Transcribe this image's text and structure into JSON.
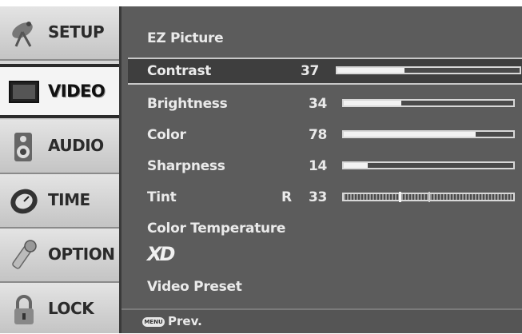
{
  "sidebar": {
    "items": [
      {
        "label": "SETUP",
        "icon": "satellite-dish-icon"
      },
      {
        "label": "VIDEO",
        "icon": "monitor-icon",
        "active": true
      },
      {
        "label": "AUDIO",
        "icon": "speaker-icon"
      },
      {
        "label": "TIME",
        "icon": "clock-icon"
      },
      {
        "label": "OPTION",
        "icon": "wrench-icon"
      },
      {
        "label": "LOCK",
        "icon": "padlock-icon"
      }
    ]
  },
  "menu": {
    "ez_picture": "EZ Picture",
    "contrast": {
      "label": "Contrast",
      "value": "37",
      "level": 0.37
    },
    "brightness": {
      "label": "Brightness",
      "value": "34",
      "level": 0.34
    },
    "color": {
      "label": "Color",
      "value": "78",
      "level": 0.78
    },
    "sharpness": {
      "label": "Sharpness",
      "value": "14",
      "level": 0.14
    },
    "tint": {
      "label": "Tint",
      "prefix": "R",
      "value": "33",
      "level": 0.33
    },
    "color_temperature": "Color Temperature",
    "xd": "XD",
    "video_preset": "Video Preset"
  },
  "footer": {
    "key": "MENU",
    "label": "Prev."
  },
  "colors": {
    "panel": "#5c5c5c",
    "sidebar": "#d6d6d6",
    "bar_fill": "#f2f2f2"
  }
}
